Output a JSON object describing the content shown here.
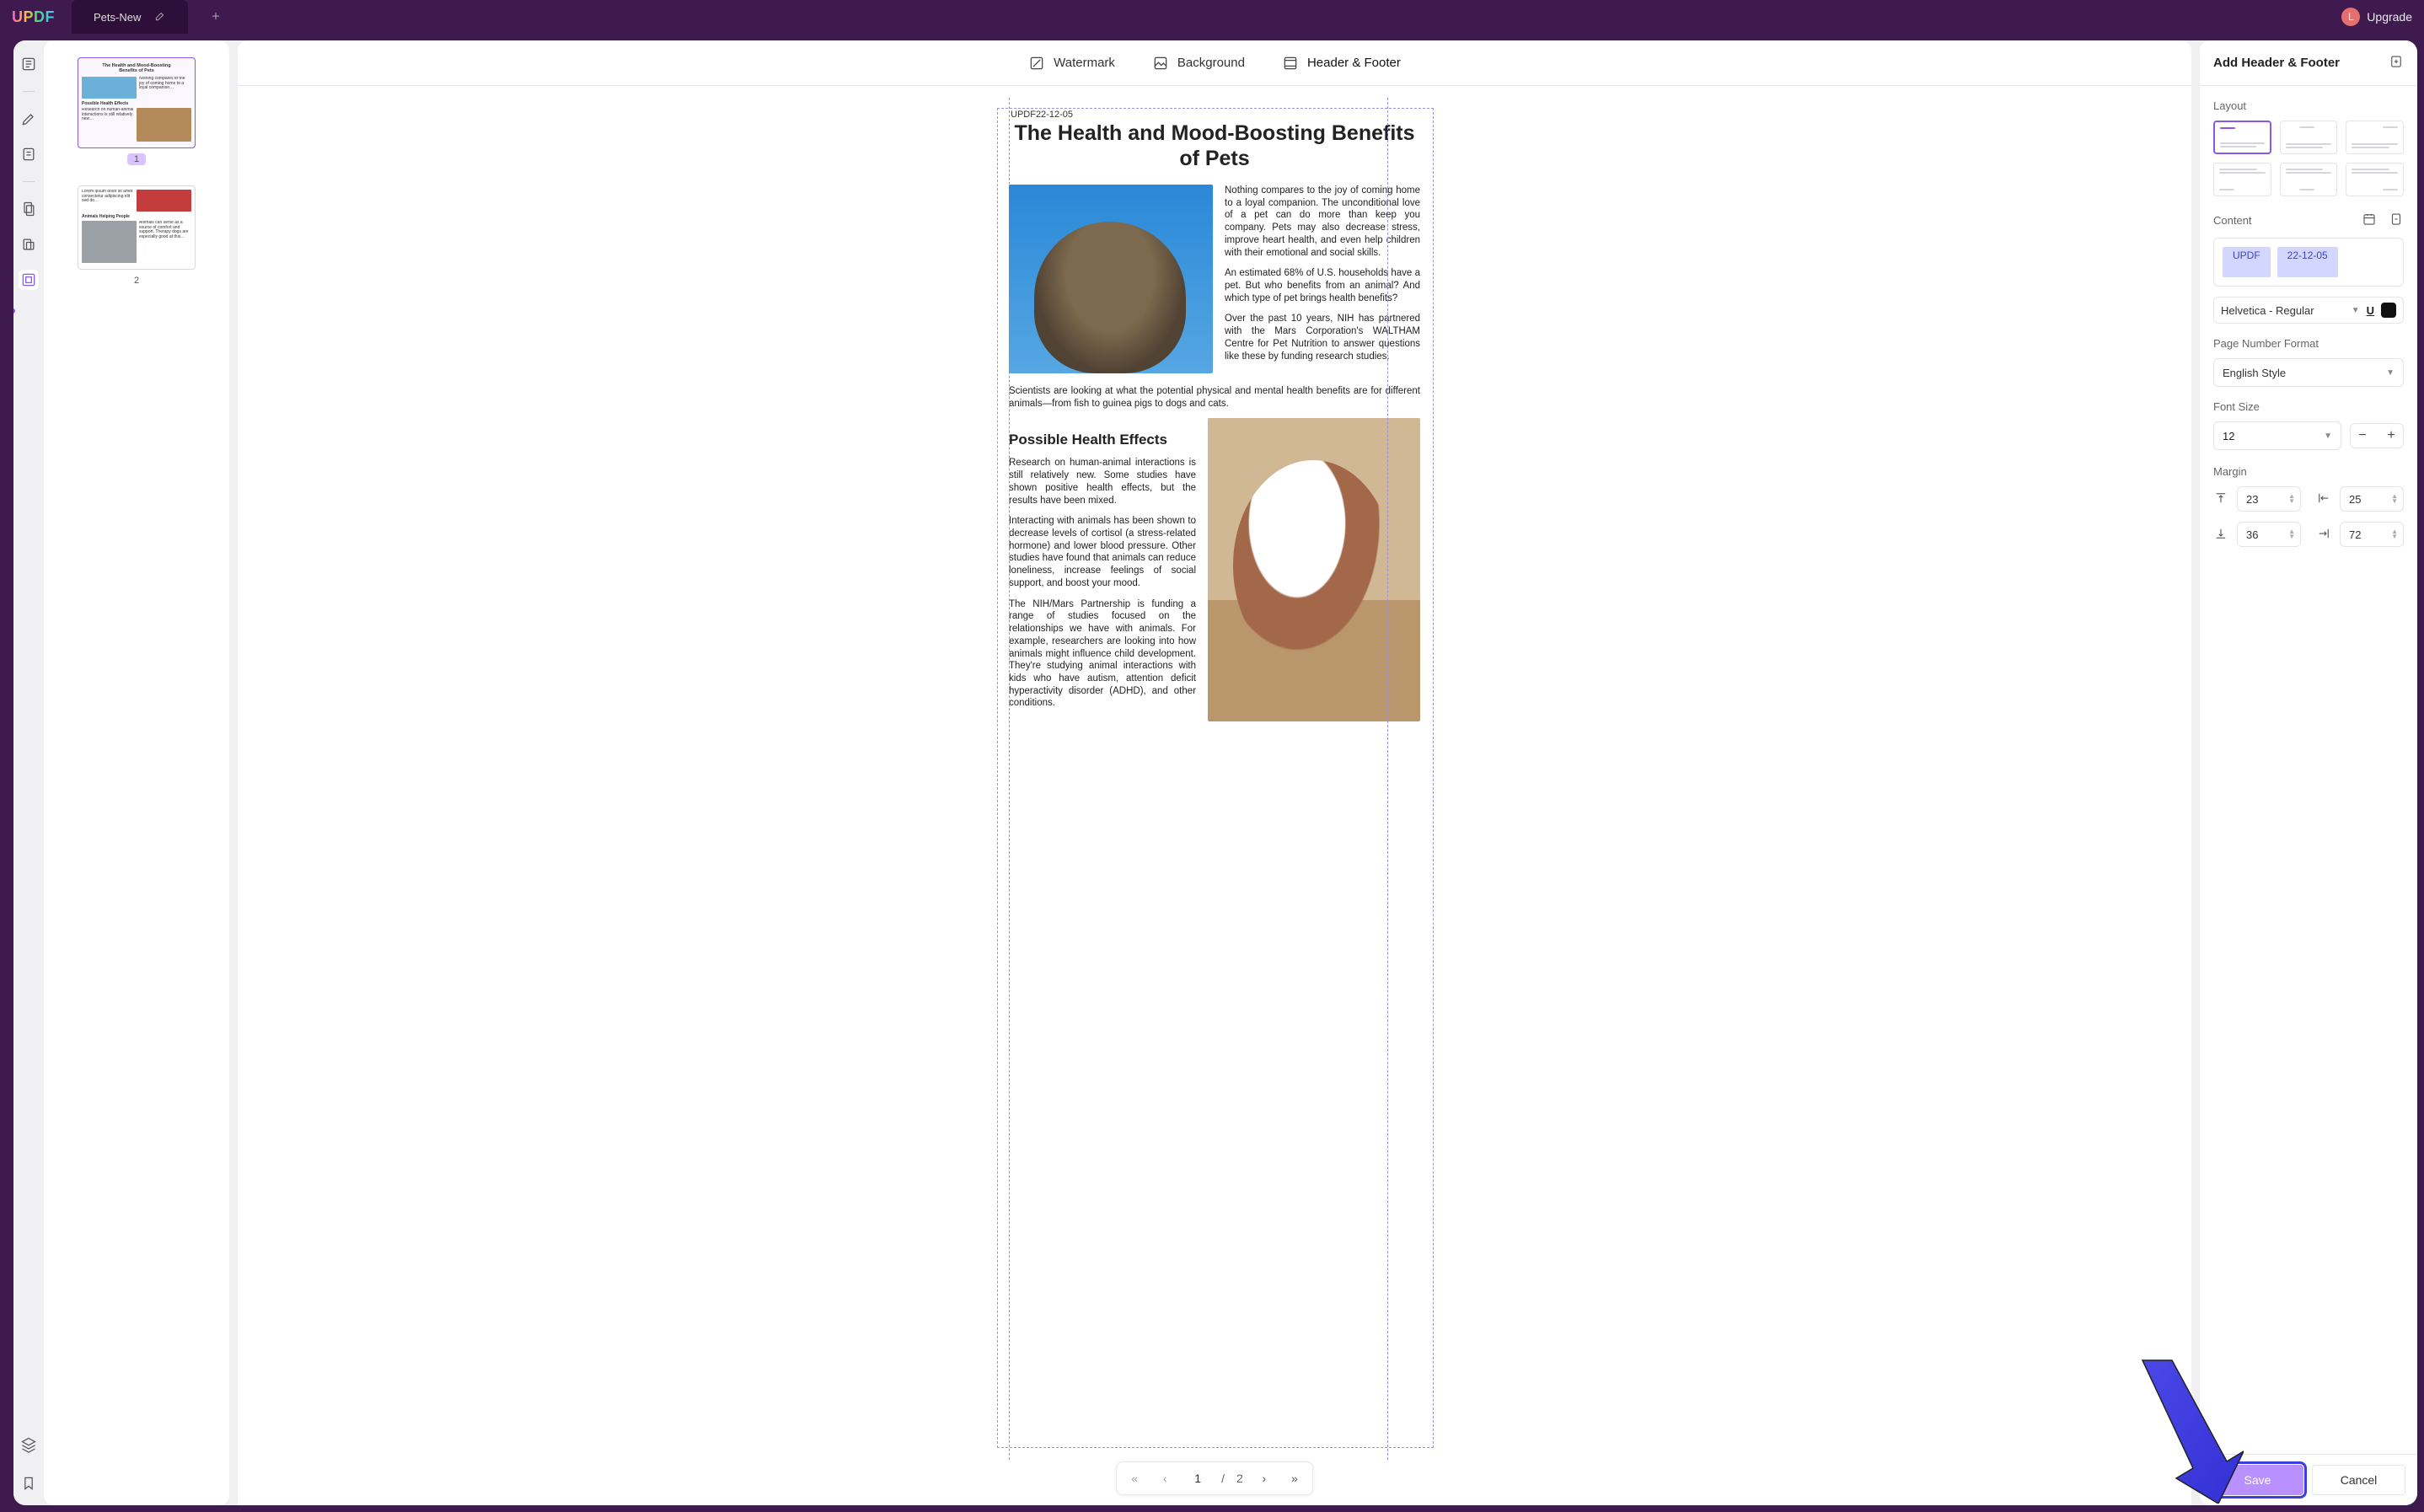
{
  "app": {
    "logo": "UPDF",
    "tab_title": "Pets-New",
    "avatar_initial": "L",
    "upgrade_label": "Upgrade"
  },
  "stage_tabs": {
    "watermark": "Watermark",
    "background": "Background",
    "header_footer": "Header & Footer"
  },
  "header_footer_preview": "UPDF22-12-05",
  "doc": {
    "title": "The Health and Mood-Boosting Benefits of Pets",
    "p1": "Nothing compares to the joy of coming home to a loyal companion. The unconditional love of a pet can do more than keep you company. Pets may also decrease stress, improve heart health, and even help children with their emotional and social skills.",
    "p2": "An estimated 68% of U.S. households have a pet. But who benefits from an animal? And which type of pet brings health benefits?",
    "p3": "Over the past 10 years, NIH has partnered with the Mars Corporation's WALTHAM Centre for Pet Nutrition to answer questions like these by funding research studies.",
    "p4": "Scientists are looking at what the potential physical and mental health benefits are for different animals—from fish to guinea pigs to dogs and cats.",
    "h2": "Possible Health Effects",
    "p5": "Research on human-animal interactions is still relatively new. Some studies have shown positive health effects, but the results have been mixed.",
    "p6": "Interacting with animals has been shown to decrease levels of cortisol (a stress-related hormone) and lower blood pressure. Other studies have found that animals can reduce loneliness, increase feelings of social support, and boost your mood.",
    "p7": "The NIH/Mars Partnership is funding a range of studies focused on the relationships we have with animals. For example, researchers are looking into how animals might influence child development. They're studying animal interactions with kids who have autism, attention deficit hyperactivity disorder (ADHD), and other conditions."
  },
  "thumbs": {
    "page1": "1",
    "page2": "2"
  },
  "pager": {
    "current": "1",
    "sep": "/",
    "total": "2"
  },
  "panel": {
    "title": "Add Header & Footer",
    "layout_label": "Layout",
    "content_label": "Content",
    "token_updf": "UPDF",
    "token_date": "22-12-05",
    "font_family": "Helvetica - Regular",
    "underline": "U",
    "page_number_label": "Page Number Format",
    "page_number_value": "English Style",
    "font_size_label": "Font Size",
    "font_size_value": "12",
    "margin_label": "Margin",
    "margin_top": "23",
    "margin_left": "25",
    "margin_bottom": "36",
    "margin_right": "72",
    "save": "Save",
    "cancel": "Cancel"
  }
}
